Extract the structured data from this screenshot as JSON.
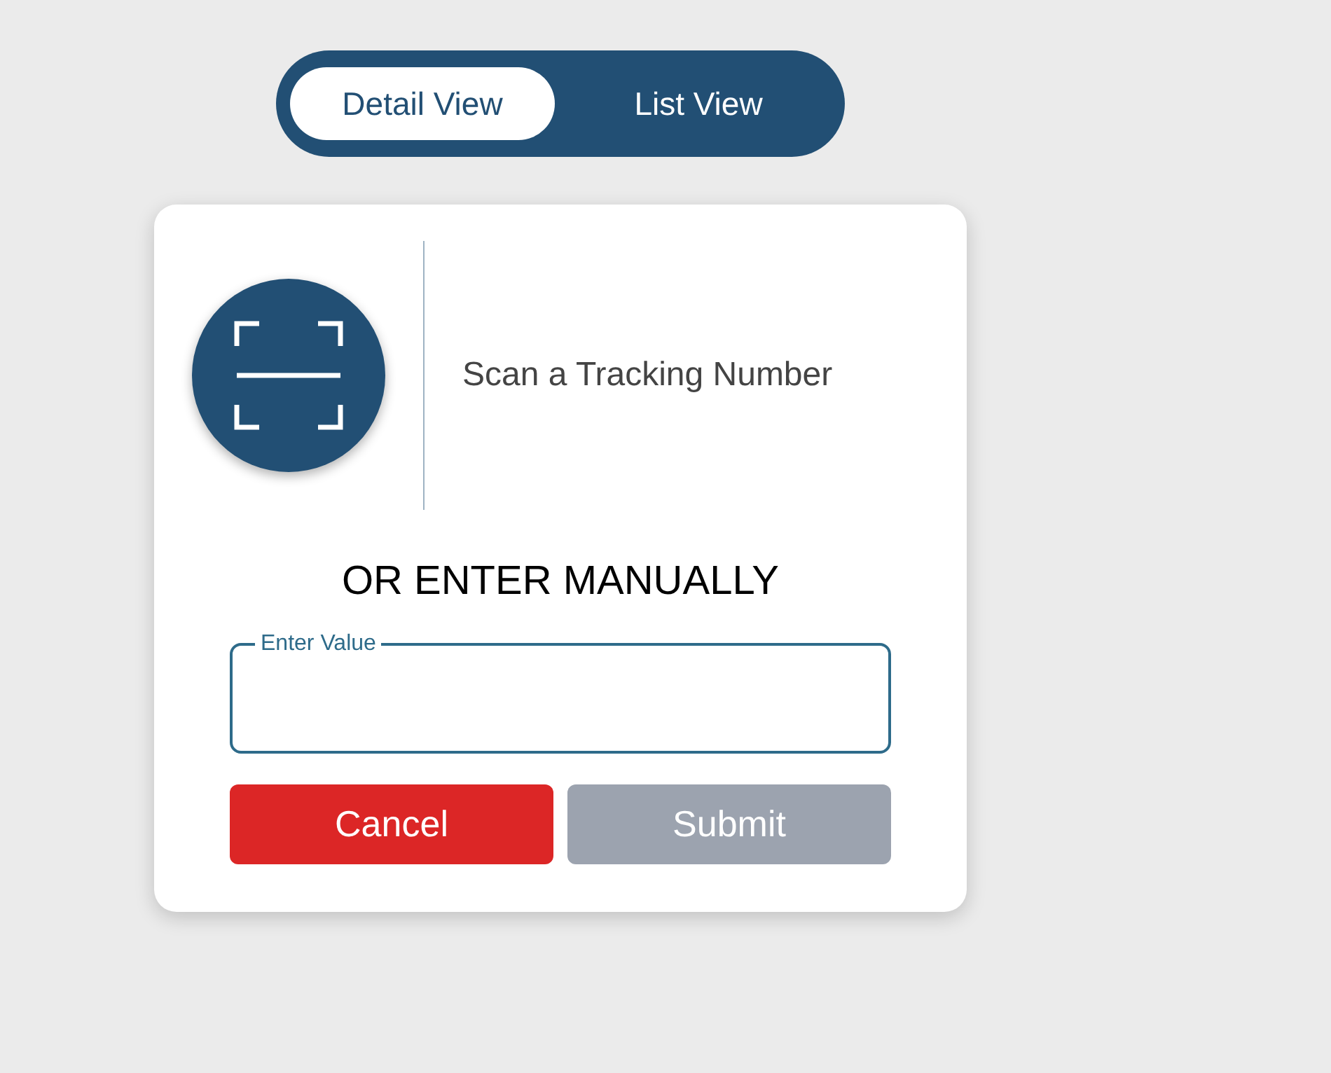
{
  "view_toggle": [
    {
      "label": "Detail View",
      "selected": true
    },
    {
      "label": "List View",
      "selected": false
    }
  ],
  "scan": {
    "text": "Scan a Tracking Number"
  },
  "manual_heading": "OR ENTER MANUALLY",
  "field": {
    "label": "Enter Value"
  },
  "buttons": [
    {
      "label": "Cancel",
      "kind": "cancel",
      "disabled": false
    },
    {
      "label": "Submit",
      "kind": "submit",
      "disabled": true
    }
  ]
}
